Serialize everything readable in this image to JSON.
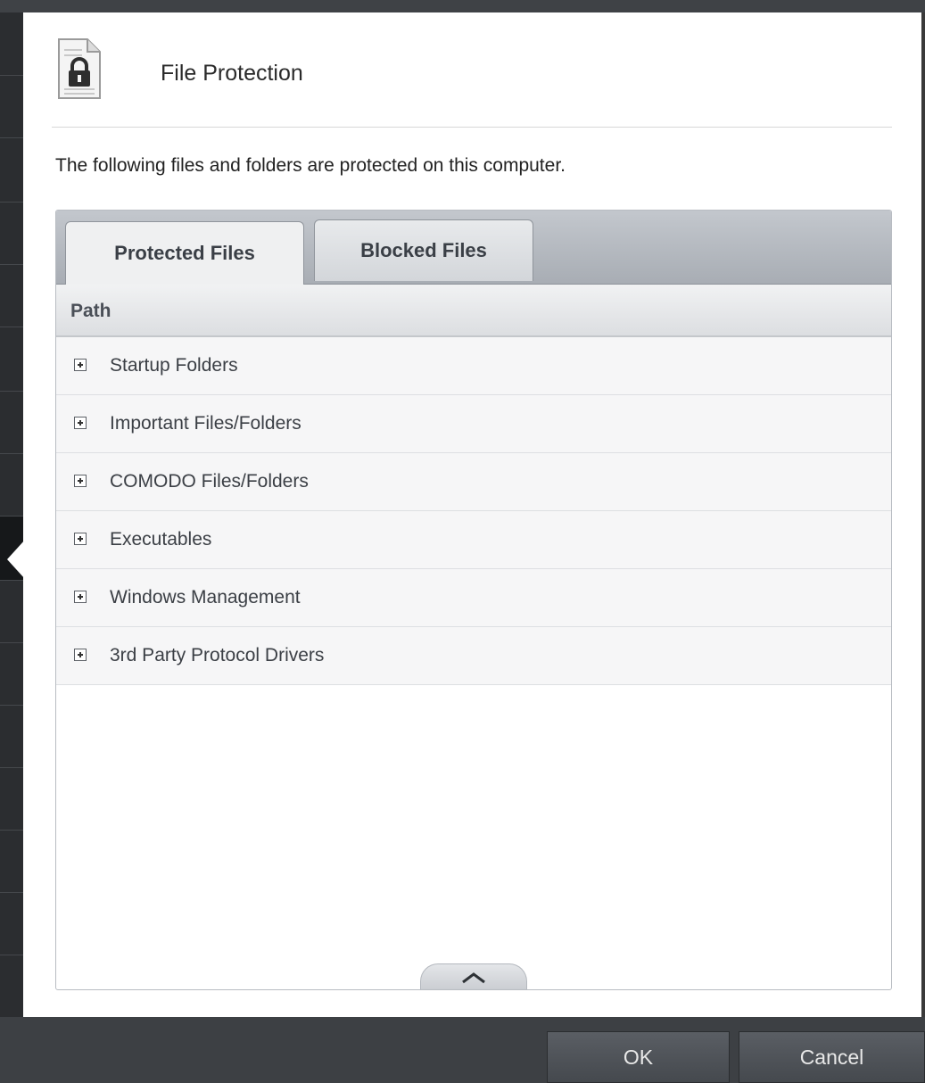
{
  "dialog": {
    "title": "File Protection",
    "icon": "locked-file-icon",
    "description": "The following files and folders are protected on this computer."
  },
  "tabs": [
    {
      "label": "Protected Files",
      "active": true
    },
    {
      "label": "Blocked Files",
      "active": false
    }
  ],
  "table": {
    "column_header": "Path",
    "rows": [
      {
        "label": "Startup Folders"
      },
      {
        "label": "Important Files/Folders"
      },
      {
        "label": "COMODO Files/Folders"
      },
      {
        "label": "Executables"
      },
      {
        "label": "Windows Management"
      },
      {
        "label": "3rd Party Protocol Drivers"
      }
    ]
  },
  "footer": {
    "ok_label": "OK",
    "cancel_label": "Cancel"
  },
  "colors": {
    "accent_dark": "#3d4044",
    "panel": "#ffffff"
  }
}
